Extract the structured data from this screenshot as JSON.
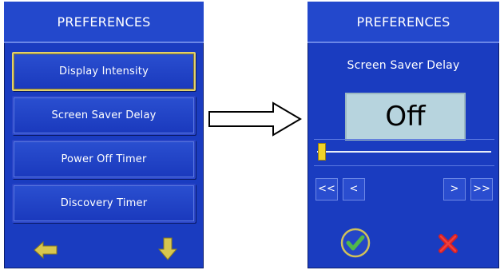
{
  "left_panel": {
    "title": "PREFERENCES",
    "menu_items": [
      {
        "label": "Display Intensity",
        "selected": true
      },
      {
        "label": "Screen Saver Delay",
        "selected": false
      },
      {
        "label": "Power Off Timer",
        "selected": false
      },
      {
        "label": "Discovery Timer",
        "selected": false
      }
    ],
    "back_icon": "left-arrow-icon",
    "next_icon": "down-arrow-icon"
  },
  "transition_icon": "right-arrow-icon",
  "right_panel": {
    "title": "PREFERENCES",
    "setting_name": "Screen Saver Delay",
    "value": "Off",
    "slider_position": 0,
    "buttons": {
      "fast_back": "<<",
      "back": "<",
      "forward": ">",
      "fast_forward": ">>"
    },
    "confirm_icon": "check-icon",
    "cancel_icon": "close-icon"
  },
  "colors": {
    "panel_blue": "#1a3cc0",
    "title_blue": "#2348cc",
    "highlight_gold": "#e1d16d",
    "slider_yellow": "#f0d22a",
    "confirm_green": "#51b84a",
    "cancel_red": "#d61f26"
  }
}
